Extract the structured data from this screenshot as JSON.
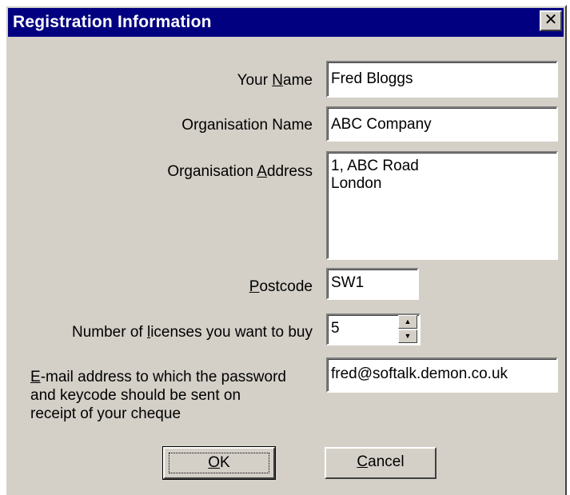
{
  "window": {
    "title": "Registration Information",
    "close_glyph": "✕"
  },
  "form": {
    "your_name": {
      "label_pre": "Your ",
      "label_key": "N",
      "label_post": "ame",
      "value": "Fred Bloggs"
    },
    "organisation_name": {
      "label": "Organisation Name",
      "value": "ABC Company"
    },
    "organisation_address": {
      "label_pre": "Organisation ",
      "label_key": "A",
      "label_post": "ddress",
      "value": "1, ABC Road\nLondon"
    },
    "postcode": {
      "label_key": "P",
      "label_post": "ostcode",
      "value": "SW1"
    },
    "licenses": {
      "label_pre": "Number of ",
      "label_key": "l",
      "label_post": "icenses you want to buy",
      "value": "5"
    },
    "email": {
      "label_key": "E",
      "label_line1_post": "-mail address to which the password",
      "label_line2": "and keycode should be sent on",
      "label_line3": "receipt of your cheque",
      "value": "fred@softalk.demon.co.uk"
    }
  },
  "buttons": {
    "ok": {
      "key": "O",
      "post": "K"
    },
    "cancel": {
      "key": "C",
      "post": "ancel"
    }
  }
}
